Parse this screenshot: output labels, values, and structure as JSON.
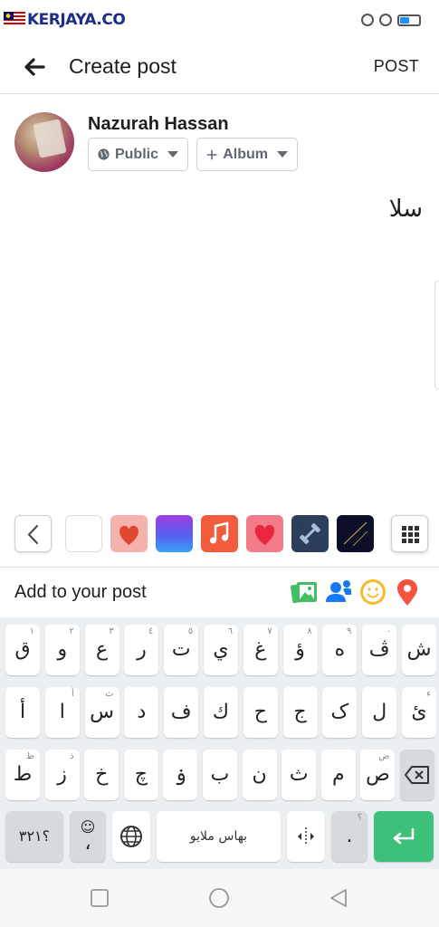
{
  "status_bar": {
    "watermark": "KERJAYA.CO",
    "battery_level": 0.45
  },
  "header": {
    "title": "Create post",
    "post_button": "POST"
  },
  "user": {
    "name": "Nazurah Hassan",
    "privacy_label": "Public",
    "album_label": "Album"
  },
  "post": {
    "text": "سلا"
  },
  "backgrounds": {
    "swatches": [
      {
        "name": "white",
        "color": "#ffffff"
      },
      {
        "name": "heart-pink",
        "color": "#f5b2ad"
      },
      {
        "name": "purple-blue-gradient",
        "color": "#7b3fe4"
      },
      {
        "name": "music-orange",
        "color": "#f25b3b"
      },
      {
        "name": "heart-red",
        "color": "#f27b8a"
      },
      {
        "name": "dumbbell-navy",
        "color": "#2d3e5c"
      },
      {
        "name": "dark-night",
        "color": "#0b0f2a"
      }
    ]
  },
  "add_to_post": {
    "label": "Add to your post",
    "icons": [
      "photo-icon",
      "tag-people-icon",
      "feeling-icon",
      "check-in-icon"
    ]
  },
  "keyboard": {
    "row1": [
      {
        "char": "ق",
        "hint": "١"
      },
      {
        "char": "و",
        "hint": "٢"
      },
      {
        "char": "ع",
        "hint": "٣"
      },
      {
        "char": "ر",
        "hint": "٤"
      },
      {
        "char": "ت",
        "hint": "٥"
      },
      {
        "char": "ي",
        "hint": "٦"
      },
      {
        "char": "غ",
        "hint": "٧"
      },
      {
        "char": "ؤ",
        "hint": "٨"
      },
      {
        "char": "ه",
        "hint": "٩"
      },
      {
        "char": "ڤ",
        "hint": "٠"
      },
      {
        "char": "ش",
        "hint": ""
      }
    ],
    "row2": [
      {
        "char": "أ",
        "hint": ""
      },
      {
        "char": "ا",
        "hint": "آ"
      },
      {
        "char": "س",
        "hint": "ث"
      },
      {
        "char": "د",
        "hint": ""
      },
      {
        "char": "ف",
        "hint": ""
      },
      {
        "char": "ك",
        "hint": ""
      },
      {
        "char": "ح",
        "hint": ""
      },
      {
        "char": "ج",
        "hint": ""
      },
      {
        "char": "ک",
        "hint": ""
      },
      {
        "char": "ل",
        "hint": ""
      },
      {
        "char": "ئ",
        "hint": "ء"
      }
    ],
    "row3": [
      {
        "char": "ط",
        "hint": "ظ"
      },
      {
        "char": "ز",
        "hint": "ذ"
      },
      {
        "char": "خ",
        "hint": ""
      },
      {
        "char": "چ",
        "hint": ""
      },
      {
        "char": "ۏ",
        "hint": ""
      },
      {
        "char": "ب",
        "hint": ""
      },
      {
        "char": "ن",
        "hint": ""
      },
      {
        "char": "ث",
        "hint": ""
      },
      {
        "char": "م",
        "hint": ""
      },
      {
        "char": "ص",
        "hint": "ض"
      }
    ],
    "numbers_key": "؟٣٢١",
    "emoji_comma_key": "،",
    "space_label": "بهاس ملايو",
    "period_key": ".",
    "period_hint": "؟"
  }
}
